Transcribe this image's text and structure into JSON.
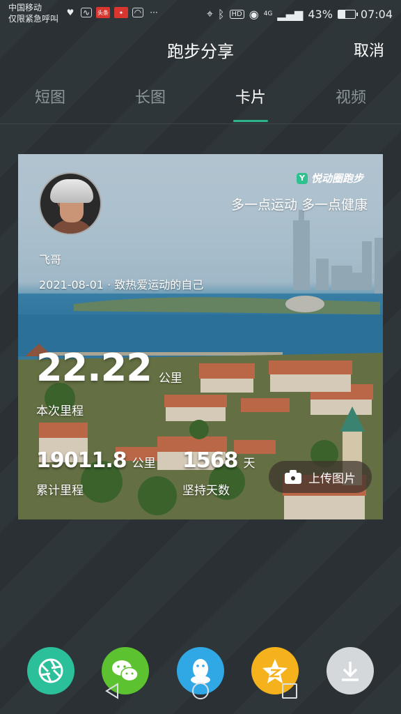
{
  "status_bar": {
    "carrier_line1": "中国移动",
    "carrier_line2": "仅限紧急呼叫",
    "left_icons": [
      "heart-rate-icon",
      "activity-icon",
      "toutiao-app-icon",
      "game-app-icon",
      "browser-app-icon",
      "more-dots-icon"
    ],
    "more": "···",
    "badge1": "头条",
    "hd": "HD",
    "signal": "4G",
    "battery_percent": "43%",
    "battery_level": 0.43,
    "time": "07:04"
  },
  "header": {
    "title": "跑步分享",
    "cancel": "取消"
  },
  "tabs": [
    {
      "label": "短图",
      "active": false
    },
    {
      "label": "长图",
      "active": false
    },
    {
      "label": "卡片",
      "active": true
    },
    {
      "label": "视频",
      "active": false
    }
  ],
  "card": {
    "brand": "悦动圈跑步",
    "brand_mark": "Y",
    "slogan": "多一点运动 多一点健康",
    "username": "飞哥",
    "date_line": "2021-08-01 · 致热爱运动的自己",
    "current": {
      "value": "22.22",
      "unit": "公里",
      "label": "本次里程"
    },
    "total": {
      "value": "19011.8",
      "unit": "公里",
      "label": "累计里程"
    },
    "days": {
      "value": "1568",
      "unit": "天",
      "label": "坚持天数"
    },
    "upload_label": "上传图片"
  },
  "share": [
    {
      "name": "moments-share",
      "color": "#2bbf9a"
    },
    {
      "name": "wechat-share",
      "color": "#5cc22f"
    },
    {
      "name": "qq-share",
      "color": "#31a8e6"
    },
    {
      "name": "qzone-share",
      "color": "#f5b21c"
    },
    {
      "name": "download-share",
      "color": "#d4d8da"
    }
  ]
}
